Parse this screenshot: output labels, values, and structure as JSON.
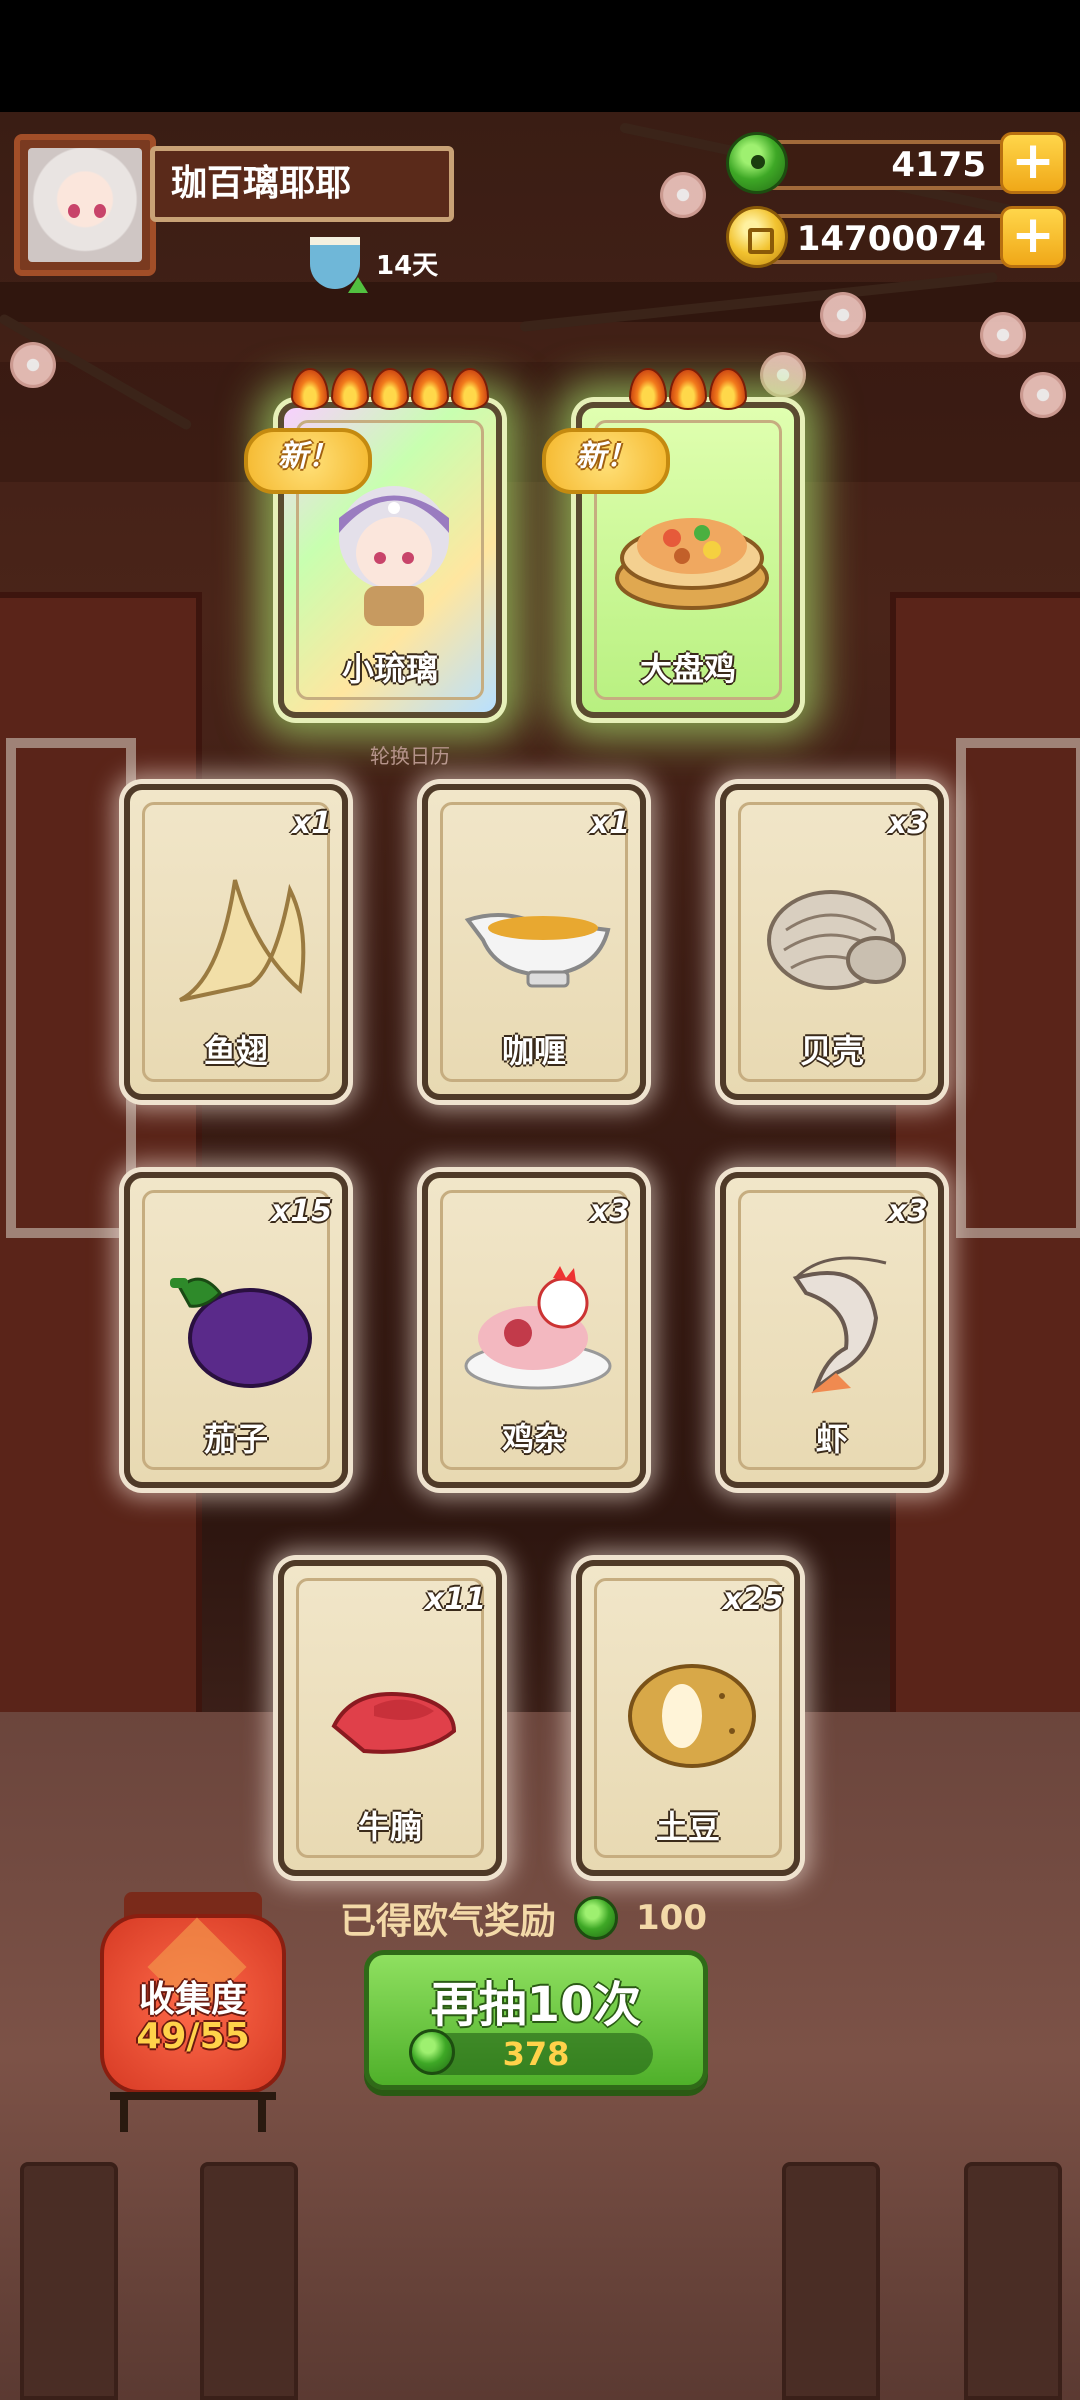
{
  "player": {
    "name": "珈百璃耶耶",
    "days": "14天",
    "avatar_icon": "player-avatar"
  },
  "currencies": [
    {
      "name": "jade",
      "icon": "green-jade-icon",
      "value": "4175",
      "add_label": "+"
    },
    {
      "name": "coins",
      "icon": "gold-coin-icon",
      "value": "14700074",
      "add_label": "+"
    }
  ],
  "new_rewards": [
    {
      "label": "小琉璃",
      "badge": "新！",
      "flames": 5,
      "icon": "character-icon"
    },
    {
      "label": "大盘鸡",
      "badge": "新！",
      "flames": 3,
      "icon": "dish-icon"
    }
  ],
  "rotation_label": "轮换日历",
  "items": [
    {
      "label": "鱼翅",
      "count": "x1",
      "icon": "shark-fin-icon"
    },
    {
      "label": "咖喱",
      "count": "x1",
      "icon": "curry-gravy-boat-icon"
    },
    {
      "label": "贝壳",
      "count": "x3",
      "icon": "clam-shell-icon"
    },
    {
      "label": "茄子",
      "count": "x15",
      "icon": "eggplant-icon"
    },
    {
      "label": "鸡杂",
      "count": "x3",
      "icon": "chicken-giblets-icon"
    },
    {
      "label": "虾",
      "count": "x3",
      "icon": "shrimp-icon"
    },
    {
      "label": "牛腩",
      "count": "x11",
      "icon": "beef-brisket-icon"
    },
    {
      "label": "土豆",
      "count": "x25",
      "icon": "potato-icon"
    }
  ],
  "reward_bar": {
    "text": "已得欧气奖励",
    "value": "100",
    "icon": "green-jade-icon"
  },
  "collection": {
    "title": "收集度",
    "progress": "49/55"
  },
  "draw_button": {
    "label": "再抽10次",
    "cost": "378",
    "icon": "green-jade-icon"
  },
  "colors": {
    "accent_green": "#4fb02a",
    "gold": "#f2c330",
    "lantern_red": "#d63a24"
  }
}
